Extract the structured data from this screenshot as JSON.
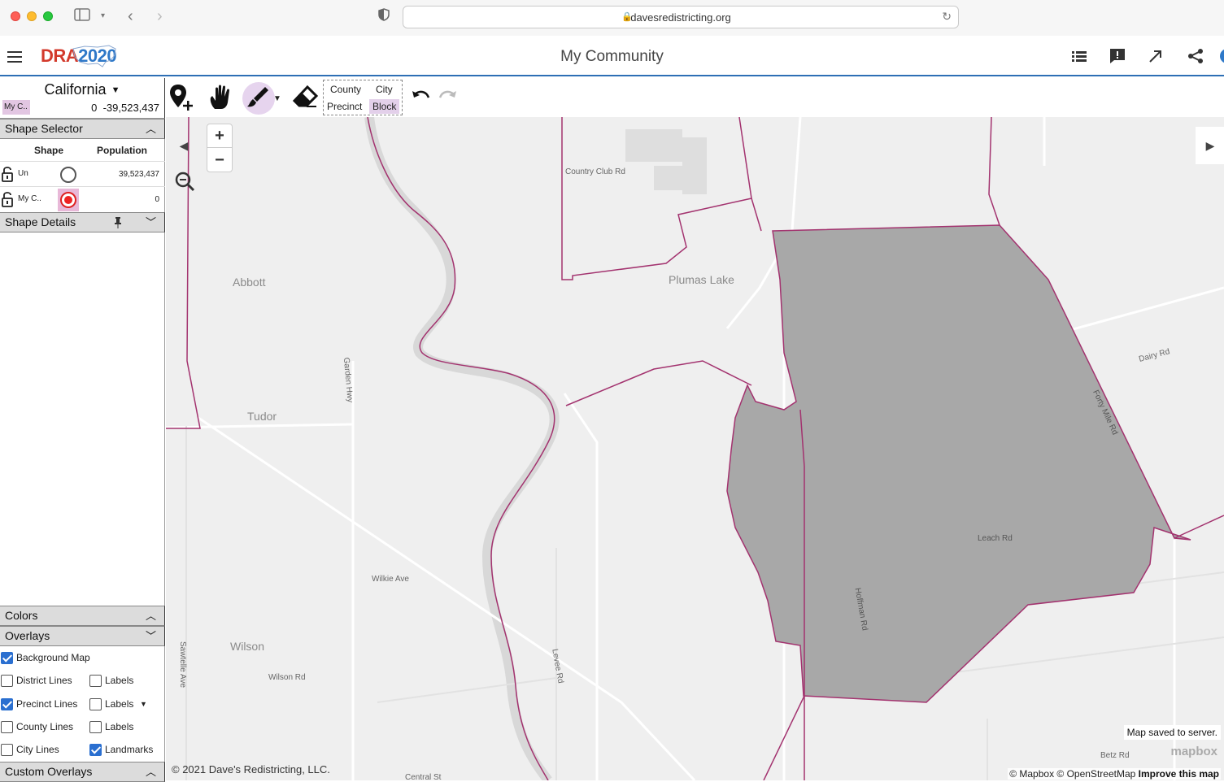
{
  "browser": {
    "url": "davesredistricting.org"
  },
  "header": {
    "logo_dra": "DRA",
    "logo_year": "2020",
    "title": "My Community"
  },
  "left_panel": {
    "state": "California",
    "state_swatch_label": "My C..",
    "state_value_a": "0",
    "state_value_b": "-39,523,437",
    "shape_selector": {
      "title": "Shape Selector",
      "columns": [
        "Shape",
        "Population"
      ],
      "rows": [
        {
          "name": "Un",
          "population": "39,523,437",
          "selected": false
        },
        {
          "name": "My C..",
          "population": "0",
          "selected": true
        }
      ]
    },
    "shape_details": {
      "title": "Shape Details"
    },
    "colors": {
      "title": "Colors"
    },
    "overlays": {
      "title": "Overlays",
      "items": [
        {
          "label": "Background Map",
          "checked": true
        },
        {
          "label": "District Lines",
          "checked": false,
          "sub_label": "Labels",
          "sub_checked": false
        },
        {
          "label": "Precinct Lines",
          "checked": true,
          "sub_label": "Labels",
          "sub_checked": false
        },
        {
          "label": "County Lines",
          "checked": false,
          "sub_label": "Labels",
          "sub_checked": false
        },
        {
          "label": "City Lines",
          "checked": false,
          "sub_label": "Landmarks",
          "sub_checked": true
        }
      ]
    },
    "custom_overlays": {
      "title": "Custom Overlays"
    }
  },
  "toolbar": {
    "granularity": {
      "county": "County",
      "city": "City",
      "precinct": "Precinct",
      "block": "Block",
      "selected": "Block"
    }
  },
  "map": {
    "places": [
      "Abbott",
      "Tudor",
      "Wilson",
      "Plumas Lake"
    ],
    "roads": [
      "Country Club Rd",
      "Garden Hwy",
      "Wilkie Ave",
      "Wilson Rd",
      "Sawtelle Ave",
      "Levee Rd",
      "Hoffman Rd",
      "Leach Rd",
      "Forty Mile Rd",
      "Dairy Rd",
      "Betz Rd",
      "Central St"
    ],
    "saved_status": "Map saved to server.",
    "copyright": "© 2021 Dave's Redistricting, LLC.",
    "attribution_a": "© Mapbox © OpenStreetMap",
    "attribution_b": "Improve this map",
    "mapbox_logo": "mapbox",
    "colors": {
      "boundary": "#a3336f",
      "selected_area": "#a8a8a8",
      "background": "#efefef"
    }
  }
}
